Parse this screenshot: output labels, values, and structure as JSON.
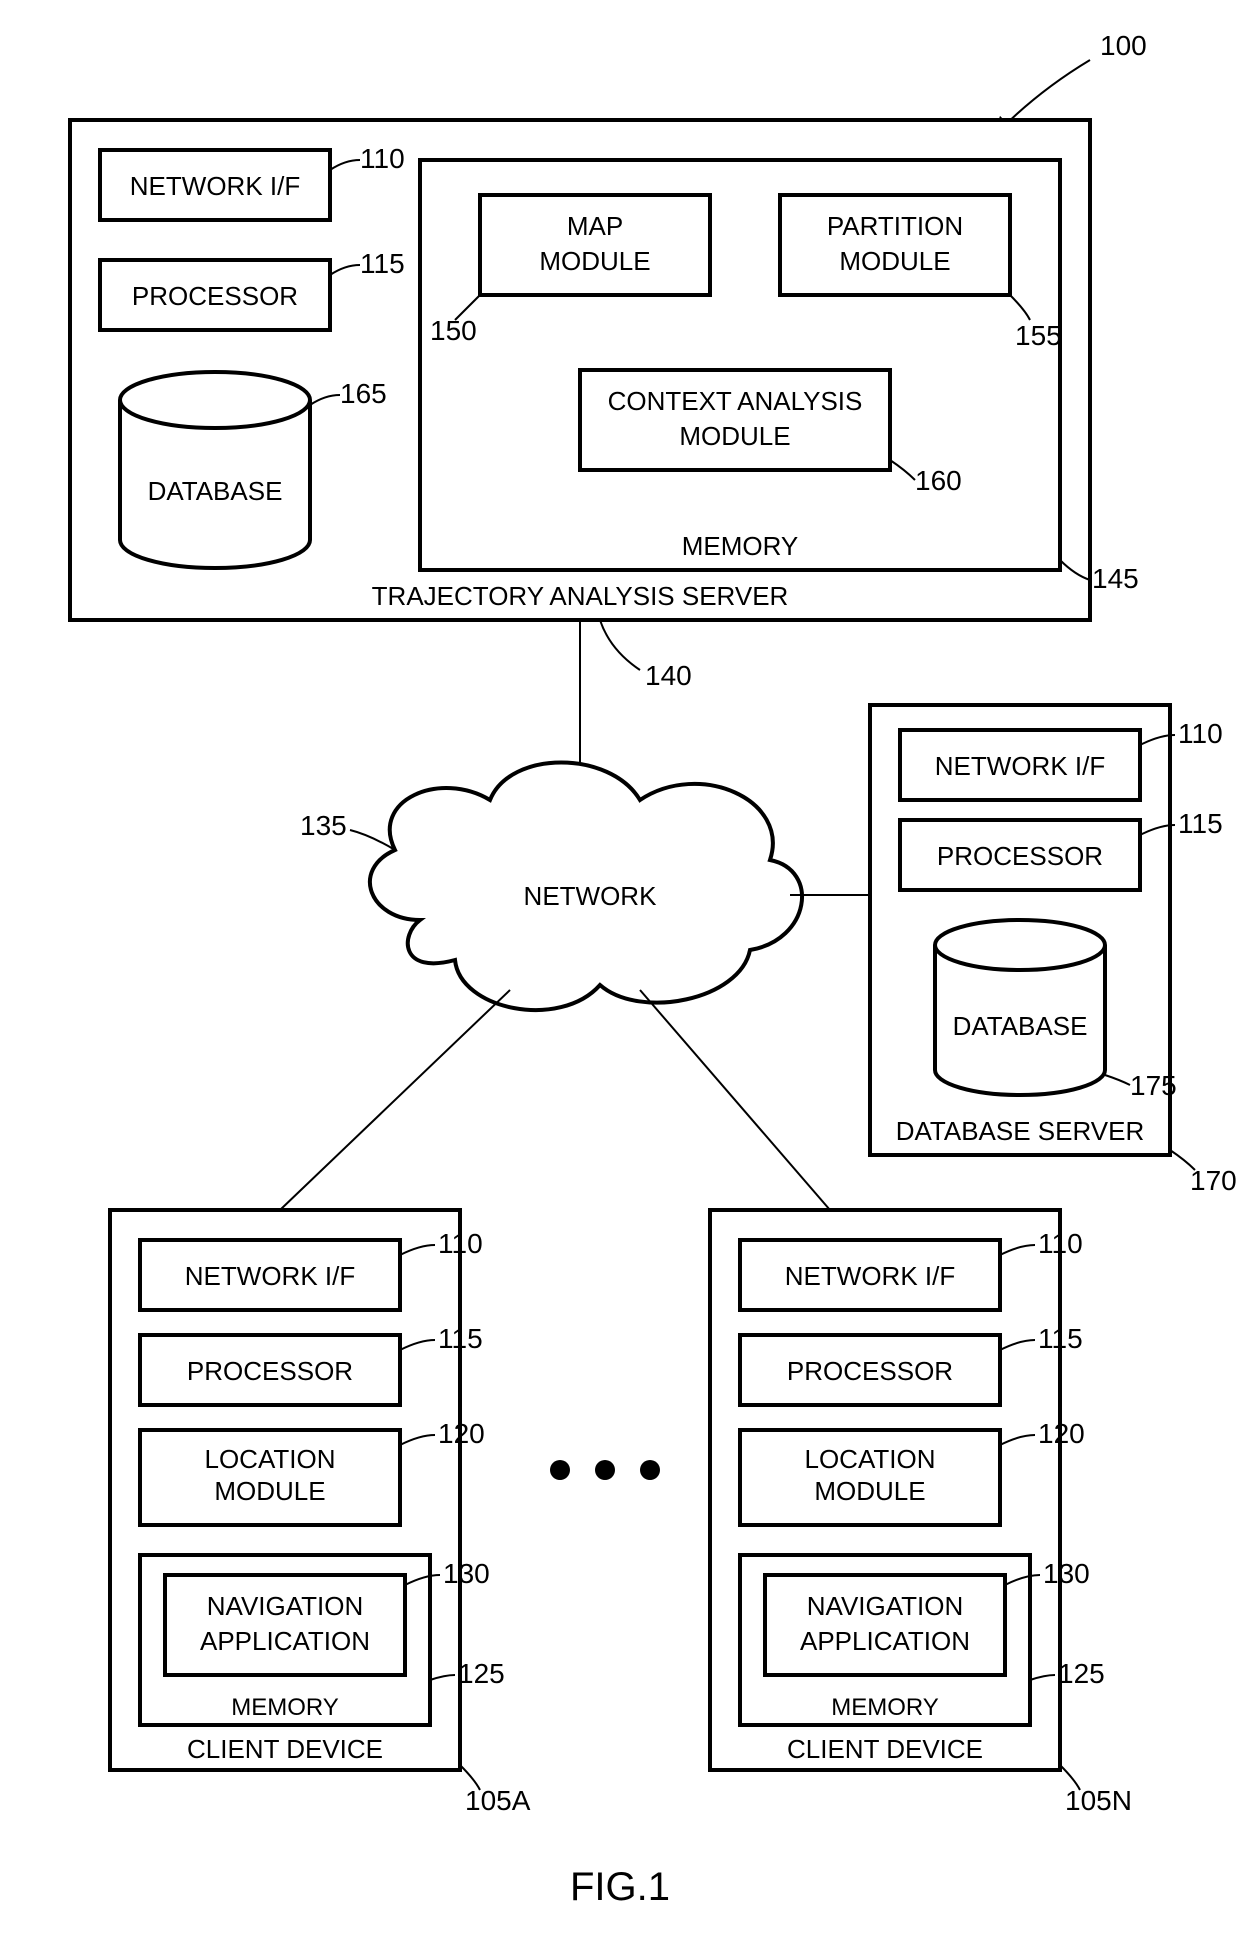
{
  "figure_caption": "FIG.1",
  "ref_100": "100",
  "server": {
    "title": "TRAJECTORY ANALYSIS SERVER",
    "ref": "140",
    "network_if": {
      "label": "NETWORK I/F",
      "ref": "110"
    },
    "processor": {
      "label": "PROCESSOR",
      "ref": "115"
    },
    "database": {
      "label": "DATABASE",
      "ref": "165"
    },
    "memory": {
      "title": "MEMORY",
      "ref": "145",
      "map_module": {
        "l1": "MAP",
        "l2": "MODULE",
        "ref": "150"
      },
      "partition_module": {
        "l1": "PARTITION",
        "l2": "MODULE",
        "ref": "155"
      },
      "context_module": {
        "l1": "CONTEXT ANALYSIS",
        "l2": "MODULE",
        "ref": "160"
      }
    }
  },
  "network": {
    "label": "NETWORK",
    "ref": "135"
  },
  "db_server": {
    "title": "DATABASE SERVER",
    "ref": "170",
    "network_if": {
      "label": "NETWORK I/F",
      "ref": "110"
    },
    "processor": {
      "label": "PROCESSOR",
      "ref": "115"
    },
    "database": {
      "label": "DATABASE",
      "ref": "175"
    }
  },
  "client_a": {
    "title": "CLIENT DEVICE",
    "ref": "105A",
    "network_if": {
      "label": "NETWORK I/F",
      "ref": "110"
    },
    "processor": {
      "label": "PROCESSOR",
      "ref": "115"
    },
    "location": {
      "l1": "LOCATION",
      "l2": "MODULE",
      "ref": "120"
    },
    "memory": {
      "title": "MEMORY",
      "ref": "125",
      "nav": {
        "l1": "NAVIGATION",
        "l2": "APPLICATION",
        "ref": "130"
      }
    }
  },
  "client_n": {
    "title": "CLIENT DEVICE",
    "ref": "105N",
    "network_if": {
      "label": "NETWORK I/F",
      "ref": "110"
    },
    "processor": {
      "label": "PROCESSOR",
      "ref": "115"
    },
    "location": {
      "l1": "LOCATION",
      "l2": "MODULE",
      "ref": "120"
    },
    "memory": {
      "title": "MEMORY",
      "ref": "125",
      "nav": {
        "l1": "NAVIGATION",
        "l2": "APPLICATION",
        "ref": "130"
      }
    }
  }
}
